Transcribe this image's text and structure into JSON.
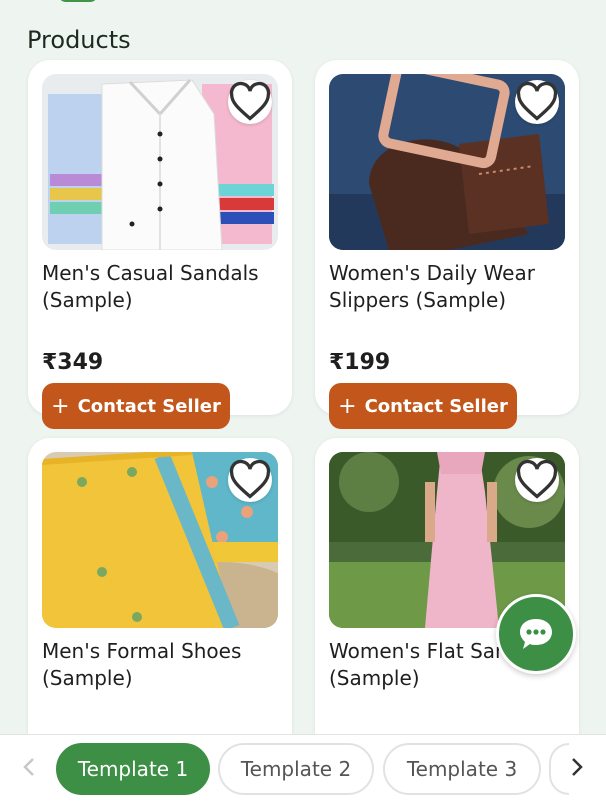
{
  "section_title": "Products",
  "products": [
    {
      "name": "Men's Casual Sandals (Sample)",
      "price": "₹349",
      "cta": "Contact Seller"
    },
    {
      "name": "Women's Daily Wear Slippers (Sample)",
      "price": "₹199",
      "cta": "Contact Seller"
    },
    {
      "name": "Men's Formal Shoes (Sample)"
    },
    {
      "name": "Women's Flat Sandals (Sample)"
    }
  ],
  "templates": [
    {
      "label": "Template 1",
      "active": true
    },
    {
      "label": "Template 2",
      "active": false
    },
    {
      "label": "Template 3",
      "active": false
    }
  ],
  "icons": {
    "favorite": "heart-outline-icon",
    "add": "plus-icon",
    "chat": "chat-bubble-icon",
    "prev": "chevron-left-icon",
    "next": "chevron-right-icon"
  },
  "colors": {
    "accent_green": "#3c8f45",
    "cta_orange": "#c2561b",
    "background": "#eef4ef"
  }
}
